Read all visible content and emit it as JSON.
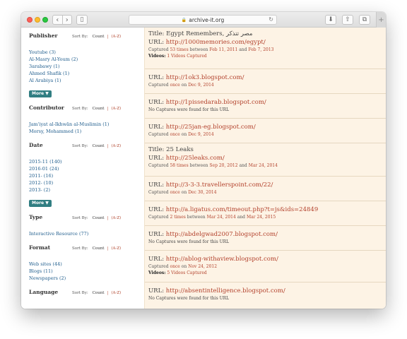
{
  "browser": {
    "url": "archive-it.org",
    "back_glyph": "‹",
    "forward_glyph": "›",
    "sidebar_glyph": "▯",
    "download_glyph": "⬇",
    "share_glyph": "⇧",
    "tabs_glyph": "⧉",
    "reload_glyph": "↻",
    "lock_glyph": "🔒",
    "new_tab_glyph": "+"
  },
  "facets": {
    "sort_by": "Sort By:",
    "count": "Count",
    "sep": "|",
    "az": "(A-Z)",
    "more": "More ▼",
    "publisher": {
      "title": "Publisher",
      "items": [
        "Youtube (3)",
        "Al-Masry Al-Youm (2)",
        "3arabawy (1)",
        "Ahmed Shafik (1)",
        "Al Arabiya (1)"
      ]
    },
    "contributor": {
      "title": "Contributor",
      "items": [
        "Jam'iyat al-Ikhwān al-Muslimin (1)",
        "Morsy, Mohammed (1)"
      ]
    },
    "date": {
      "title": "Date",
      "items": [
        "2015-11 (140)",
        "2016-01 (24)",
        "2011- (16)",
        "2012- (10)",
        "2013- (2)"
      ]
    },
    "type": {
      "title": "Type",
      "items": [
        "Interactive Resource (77)"
      ]
    },
    "format": {
      "title": "Format",
      "items": [
        "Web sites (44)",
        "Blogs (11)",
        "Newspapers (2)"
      ]
    },
    "language": {
      "title": "Language"
    }
  },
  "results": {
    "r1": {
      "title": "Title: Egypt Remembers, مصر تتذكر",
      "url_label": "URL:",
      "url": "http://1000memories.com/egypt/",
      "cap_pre": "Captured",
      "cap_times": "53 times",
      "cap_between": "between",
      "cap_from": "Feb 11, 2011",
      "cap_and": "and",
      "cap_to": "Feb 7, 2013",
      "videos_label": "Videos:",
      "videos_value": "1 Videos Captured"
    },
    "r2": {
      "url_label": "URL:",
      "url": "http://1ok3.blogspot.com/",
      "cap_pre": "Captured",
      "cap_times": "once",
      "cap_on": "on",
      "cap_date": "Dec 9, 2014"
    },
    "r3": {
      "url_label": "URL:",
      "url": "http://1pissedarab.blogspot.com/",
      "none": "No Captures were found for this URL"
    },
    "r4": {
      "url_label": "URL:",
      "url": "http://25jan-eg.blogspot.com/",
      "cap_pre": "Captured",
      "cap_times": "once",
      "cap_on": "on",
      "cap_date": "Dec 9, 2014"
    },
    "r5": {
      "title": "Title: 25 Leaks",
      "url_label": "URL:",
      "url": "http://25leaks.com/",
      "cap_pre": "Captured",
      "cap_times": "58 times",
      "cap_between": "between",
      "cap_from": "Sep 20, 2012",
      "cap_and": "and",
      "cap_to": "Mar 24, 2014"
    },
    "r6": {
      "url_label": "URL:",
      "url": "http://3-3-3.travellerspoint.com/22/",
      "cap_pre": "Captured",
      "cap_times": "once",
      "cap_on": "on",
      "cap_date": "Dec 30, 2014"
    },
    "r7": {
      "url_label": "URL:",
      "url": "http://a.ligatus.com/timeout.php?t=js&ids=24849",
      "cap_pre": "Captured",
      "cap_times": "2 times",
      "cap_between": "between",
      "cap_from": "Mar 24, 2014",
      "cap_and": "and",
      "cap_to": "Mar 24, 2015"
    },
    "r8": {
      "url_label": "URL:",
      "url": "http://abdelgwad2007.blogspot.com/",
      "none": "No Captures were found for this URL"
    },
    "r9": {
      "url_label": "URL:",
      "url": "http://ablog-withaview.blogspot.com/",
      "cap_pre": "Captured",
      "cap_times": "once",
      "cap_on": "on",
      "cap_date": "Nov 24, 2012",
      "videos_label": "Videos:",
      "videos_value": "5 Videos Captured"
    },
    "r10": {
      "url_label": "URL:",
      "url": "http://absentintelligence.blogspot.com/",
      "none": "No Captures were found for this URL"
    }
  }
}
